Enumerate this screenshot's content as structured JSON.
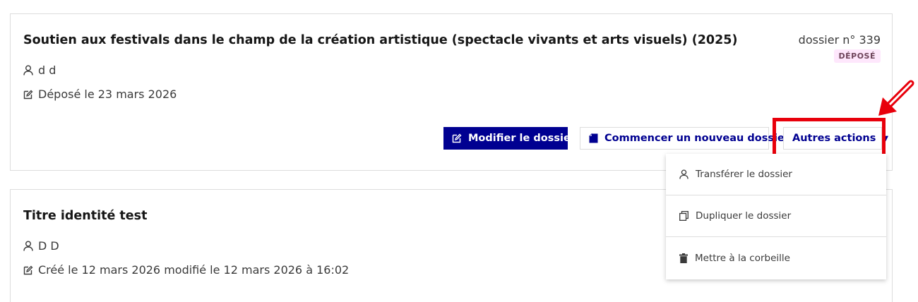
{
  "dossiers": [
    {
      "title": "Soutien aux festivals dans le champ de la création artistique (spectacle vivants et arts visuels) (2025)",
      "owner": "d d",
      "date_text": "Déposé le 23 mars 2026",
      "number": "dossier n° 339",
      "status": "DÉPOSÉ",
      "actions": {
        "modify_label": "Modifier le dossier",
        "new_label": "Commencer un nouveau dossier",
        "more_label": "Autres actions"
      }
    },
    {
      "title": "Titre identité test",
      "owner": "D D",
      "date_text": "Créé le 12 mars 2026 modifié le 12 mars 2026 à 16:02"
    }
  ],
  "dropdown": {
    "items": [
      {
        "label": "Transférer le dossier",
        "icon": "user-icon"
      },
      {
        "label": "Dupliquer le dossier",
        "icon": "copy-icon"
      },
      {
        "label": "Mettre à la corbeille",
        "icon": "trash-icon"
      }
    ]
  },
  "colors": {
    "primary": "#000091",
    "badge_bg": "#fee7fc",
    "badge_text": "#6e445a",
    "highlight": "#e8000b"
  }
}
